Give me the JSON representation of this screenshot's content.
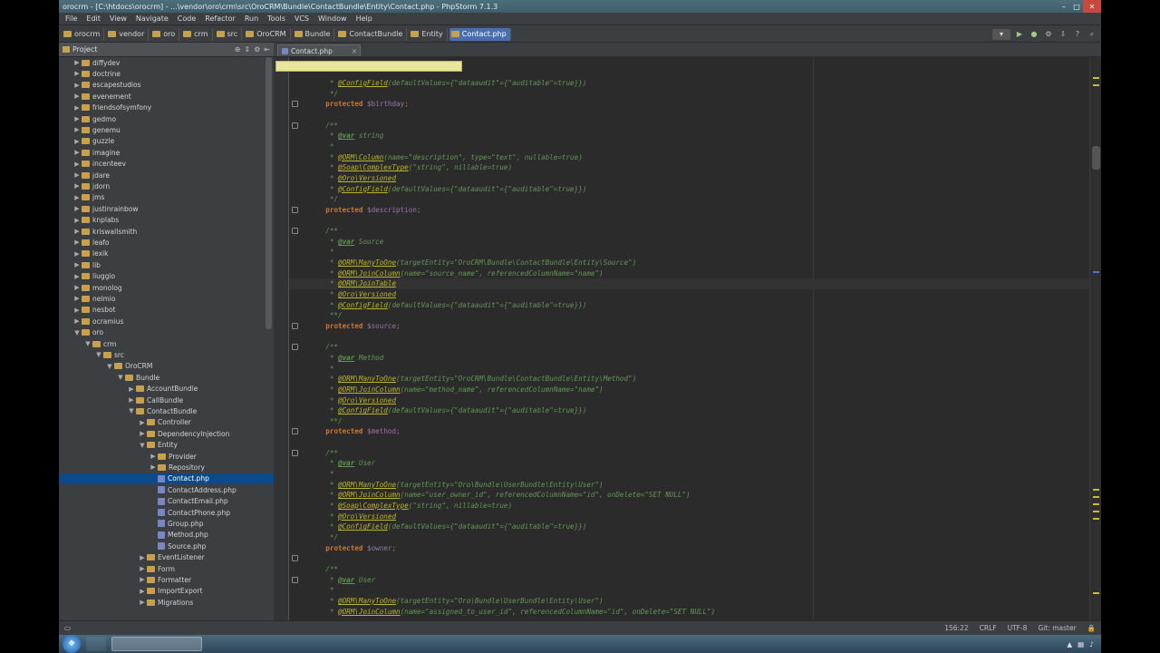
{
  "window": {
    "title": "orocrm - [C:\\htdocs\\orocrm] - ...\\vendor\\oro\\crm\\src\\OroCRM\\Bundle\\ContactBundle\\Entity\\Contact.php - PhpStorm 7.1.3"
  },
  "menu": [
    "File",
    "Edit",
    "View",
    "Navigate",
    "Code",
    "Refactor",
    "Run",
    "Tools",
    "VCS",
    "Window",
    "Help"
  ],
  "breadcrumbs": [
    "orocrm",
    "vendor",
    "oro",
    "crm",
    "src",
    "OroCRM",
    "Bundle",
    "ContactBundle",
    "Entity",
    "Contact.php"
  ],
  "project": {
    "title": "Project",
    "tree": [
      {
        "label": "diffydev",
        "depth": 3,
        "type": "folder",
        "arrow": "▶"
      },
      {
        "label": "doctrine",
        "depth": 3,
        "type": "folder",
        "arrow": "▶"
      },
      {
        "label": "escapestudios",
        "depth": 3,
        "type": "folder",
        "arrow": "▶"
      },
      {
        "label": "evenement",
        "depth": 3,
        "type": "folder",
        "arrow": "▶"
      },
      {
        "label": "friendsofsymfony",
        "depth": 3,
        "type": "folder",
        "arrow": "▶"
      },
      {
        "label": "gedmo",
        "depth": 3,
        "type": "folder",
        "arrow": "▶"
      },
      {
        "label": "genemu",
        "depth": 3,
        "type": "folder",
        "arrow": "▶"
      },
      {
        "label": "guzzle",
        "depth": 3,
        "type": "folder",
        "arrow": "▶"
      },
      {
        "label": "imagine",
        "depth": 3,
        "type": "folder",
        "arrow": "▶"
      },
      {
        "label": "incenteev",
        "depth": 3,
        "type": "folder",
        "arrow": "▶"
      },
      {
        "label": "jdare",
        "depth": 3,
        "type": "folder",
        "arrow": "▶"
      },
      {
        "label": "jdorn",
        "depth": 3,
        "type": "folder",
        "arrow": "▶"
      },
      {
        "label": "jms",
        "depth": 3,
        "type": "folder",
        "arrow": "▶"
      },
      {
        "label": "justinrainbow",
        "depth": 3,
        "type": "folder",
        "arrow": "▶"
      },
      {
        "label": "knplabs",
        "depth": 3,
        "type": "folder",
        "arrow": "▶"
      },
      {
        "label": "kriswallsmith",
        "depth": 3,
        "type": "folder",
        "arrow": "▶"
      },
      {
        "label": "leafo",
        "depth": 3,
        "type": "folder",
        "arrow": "▶"
      },
      {
        "label": "lexik",
        "depth": 3,
        "type": "folder",
        "arrow": "▶"
      },
      {
        "label": "lib",
        "depth": 3,
        "type": "folder",
        "arrow": "▶"
      },
      {
        "label": "liuggio",
        "depth": 3,
        "type": "folder",
        "arrow": "▶"
      },
      {
        "label": "monolog",
        "depth": 3,
        "type": "folder",
        "arrow": "▶"
      },
      {
        "label": "nelmio",
        "depth": 3,
        "type": "folder",
        "arrow": "▶"
      },
      {
        "label": "nesbot",
        "depth": 3,
        "type": "folder",
        "arrow": "▶"
      },
      {
        "label": "ocramius",
        "depth": 3,
        "type": "folder",
        "arrow": "▶"
      },
      {
        "label": "oro",
        "depth": 3,
        "type": "folder",
        "arrow": "▼"
      },
      {
        "label": "crm",
        "depth": 4,
        "type": "folder",
        "arrow": "▼"
      },
      {
        "label": "src",
        "depth": 5,
        "type": "folder",
        "arrow": "▼"
      },
      {
        "label": "OroCRM",
        "depth": 6,
        "type": "folder",
        "arrow": "▼"
      },
      {
        "label": "Bundle",
        "depth": 7,
        "type": "folder",
        "arrow": "▼"
      },
      {
        "label": "AccountBundle",
        "depth": 8,
        "type": "folder",
        "arrow": "▶"
      },
      {
        "label": "CallBundle",
        "depth": 8,
        "type": "folder",
        "arrow": "▶"
      },
      {
        "label": "ContactBundle",
        "depth": 8,
        "type": "folder",
        "arrow": "▼"
      },
      {
        "label": "Controller",
        "depth": 9,
        "type": "folder",
        "arrow": "▶"
      },
      {
        "label": "DependencyInjection",
        "depth": 9,
        "type": "folder",
        "arrow": "▶"
      },
      {
        "label": "Entity",
        "depth": 9,
        "type": "folder",
        "arrow": "▼"
      },
      {
        "label": "Provider",
        "depth": 10,
        "type": "folder",
        "arrow": "▶"
      },
      {
        "label": "Repository",
        "depth": 10,
        "type": "folder",
        "arrow": "▶"
      },
      {
        "label": "Contact.php",
        "depth": 10,
        "type": "php",
        "arrow": "",
        "selected": true
      },
      {
        "label": "ContactAddress.php",
        "depth": 10,
        "type": "php",
        "arrow": ""
      },
      {
        "label": "ContactEmail.php",
        "depth": 10,
        "type": "php",
        "arrow": ""
      },
      {
        "label": "ContactPhone.php",
        "depth": 10,
        "type": "php",
        "arrow": ""
      },
      {
        "label": "Group.php",
        "depth": 10,
        "type": "php",
        "arrow": ""
      },
      {
        "label": "Method.php",
        "depth": 10,
        "type": "php",
        "arrow": ""
      },
      {
        "label": "Source.php",
        "depth": 10,
        "type": "php",
        "arrow": ""
      },
      {
        "label": "EventListener",
        "depth": 9,
        "type": "folder",
        "arrow": "▶"
      },
      {
        "label": "Form",
        "depth": 9,
        "type": "folder",
        "arrow": "▶"
      },
      {
        "label": "Formatter",
        "depth": 9,
        "type": "folder",
        "arrow": "▶"
      },
      {
        "label": "ImportExport",
        "depth": 9,
        "type": "folder",
        "arrow": "▶"
      },
      {
        "label": "Migrations",
        "depth": 9,
        "type": "folder",
        "arrow": "▶"
      }
    ]
  },
  "editor": {
    "tab": "Contact.php",
    "lines": [
      [
        {
          "t": "     * "
        },
        {
          "t": "@ConfigField",
          "c": "ann"
        },
        {
          "t": "(defaultValues={\"dataaudit\"={\"auditable\"=true}})"
        }
      ],
      [
        {
          "t": "     */"
        }
      ],
      [
        {
          "t": "    "
        },
        {
          "t": "protected",
          "c": "kw"
        },
        {
          "t": " "
        },
        {
          "t": "$birthday",
          "c": "var"
        },
        {
          "t": ";",
          "c": "semi"
        }
      ],
      [
        {
          "t": ""
        }
      ],
      [
        {
          "t": "    /**"
        }
      ],
      [
        {
          "t": "     * "
        },
        {
          "t": "@var",
          "c": "tag"
        },
        {
          "t": " string"
        }
      ],
      [
        {
          "t": "     *"
        }
      ],
      [
        {
          "t": "     * "
        },
        {
          "t": "@ORM\\Column",
          "c": "ann"
        },
        {
          "t": "(name=\"description\", type=\"text\", nullable=true)"
        }
      ],
      [
        {
          "t": "     * "
        },
        {
          "t": "@Soap\\ComplexType",
          "c": "ann"
        },
        {
          "t": "(\"string\", nillable=true)"
        }
      ],
      [
        {
          "t": "     * "
        },
        {
          "t": "@Oro\\Versioned",
          "c": "ann"
        }
      ],
      [
        {
          "t": "     * "
        },
        {
          "t": "@ConfigField",
          "c": "ann"
        },
        {
          "t": "(defaultValues={\"dataaudit\"={\"auditable\"=true}})"
        }
      ],
      [
        {
          "t": "     */"
        }
      ],
      [
        {
          "t": "    "
        },
        {
          "t": "protected",
          "c": "kw"
        },
        {
          "t": " "
        },
        {
          "t": "$description",
          "c": "var"
        },
        {
          "t": ";",
          "c": "semi"
        }
      ],
      [
        {
          "t": ""
        }
      ],
      [
        {
          "t": "    /**"
        }
      ],
      [
        {
          "t": "     * "
        },
        {
          "t": "@var",
          "c": "tag"
        },
        {
          "t": " Source"
        }
      ],
      [
        {
          "t": "     *"
        }
      ],
      [
        {
          "t": "     * "
        },
        {
          "t": "@ORM\\ManyToOne",
          "c": "ann"
        },
        {
          "t": "(targetEntity=\"OroCRM\\Bundle\\ContactBundle\\Entity\\Source\")"
        }
      ],
      [
        {
          "t": "     * "
        },
        {
          "t": "@ORM\\JoinColumn",
          "c": "ann"
        },
        {
          "t": "(name=\"source_name\", referencedColumnName=\"name\")"
        }
      ],
      [
        {
          "t": "     * "
        },
        {
          "t": "@ORM\\JoinTable",
          "c": "ann"
        }
      ],
      [
        {
          "t": "     * "
        },
        {
          "t": "@Oro\\Versioned",
          "c": "ann"
        }
      ],
      [
        {
          "t": "     * "
        },
        {
          "t": "@ConfigField",
          "c": "ann"
        },
        {
          "t": "(defaultValues={\"dataaudit\"={\"auditable\"=true}})"
        }
      ],
      [
        {
          "t": "     **/"
        }
      ],
      [
        {
          "t": "    "
        },
        {
          "t": "protected",
          "c": "kw"
        },
        {
          "t": " "
        },
        {
          "t": "$source",
          "c": "var"
        },
        {
          "t": ";",
          "c": "semi"
        }
      ],
      [
        {
          "t": ""
        }
      ],
      [
        {
          "t": "    /**"
        }
      ],
      [
        {
          "t": "     * "
        },
        {
          "t": "@var",
          "c": "tag"
        },
        {
          "t": " Method"
        }
      ],
      [
        {
          "t": "     *"
        }
      ],
      [
        {
          "t": "     * "
        },
        {
          "t": "@ORM\\ManyToOne",
          "c": "ann"
        },
        {
          "t": "(targetEntity=\"OroCRM\\Bundle\\ContactBundle\\Entity\\Method\")"
        }
      ],
      [
        {
          "t": "     * "
        },
        {
          "t": "@ORM\\JoinColumn",
          "c": "ann"
        },
        {
          "t": "(name=\"method_name\", referencedColumnName=\"name\")"
        }
      ],
      [
        {
          "t": "     * "
        },
        {
          "t": "@Oro\\Versioned",
          "c": "ann"
        }
      ],
      [
        {
          "t": "     * "
        },
        {
          "t": "@ConfigField",
          "c": "ann"
        },
        {
          "t": "(defaultValues={\"dataaudit\"={\"auditable\"=true}})"
        }
      ],
      [
        {
          "t": "     **/"
        }
      ],
      [
        {
          "t": "    "
        },
        {
          "t": "protected",
          "c": "kw"
        },
        {
          "t": " "
        },
        {
          "t": "$method",
          "c": "var"
        },
        {
          "t": ";",
          "c": "semi"
        }
      ],
      [
        {
          "t": ""
        }
      ],
      [
        {
          "t": "    /**"
        }
      ],
      [
        {
          "t": "     * "
        },
        {
          "t": "@var",
          "c": "tag"
        },
        {
          "t": " User"
        }
      ],
      [
        {
          "t": "     *"
        }
      ],
      [
        {
          "t": "     * "
        },
        {
          "t": "@ORM\\ManyToOne",
          "c": "ann"
        },
        {
          "t": "(targetEntity=\"Oro\\Bundle\\UserBundle\\Entity\\User\")"
        }
      ],
      [
        {
          "t": "     * "
        },
        {
          "t": "@ORM\\JoinColumn",
          "c": "ann"
        },
        {
          "t": "(name=\"user_owner_id\", referencedColumnName=\"id\", onDelete=\"SET NULL\")"
        }
      ],
      [
        {
          "t": "     * "
        },
        {
          "t": "@Soap\\ComplexType",
          "c": "ann"
        },
        {
          "t": "(\"string\", nillable=true)"
        }
      ],
      [
        {
          "t": "     * "
        },
        {
          "t": "@Oro\\Versioned",
          "c": "ann"
        }
      ],
      [
        {
          "t": "     * "
        },
        {
          "t": "@ConfigField",
          "c": "ann"
        },
        {
          "t": "(defaultValues={\"dataaudit\"={\"auditable\"=true}})"
        }
      ],
      [
        {
          "t": "     */"
        }
      ],
      [
        {
          "t": "    "
        },
        {
          "t": "protected",
          "c": "kw"
        },
        {
          "t": " "
        },
        {
          "t": "$owner",
          "c": "var"
        },
        {
          "t": ";",
          "c": "semi"
        }
      ],
      [
        {
          "t": ""
        }
      ],
      [
        {
          "t": "    /**"
        }
      ],
      [
        {
          "t": "     * "
        },
        {
          "t": "@var",
          "c": "tag"
        },
        {
          "t": " User"
        }
      ],
      [
        {
          "t": "     *"
        }
      ],
      [
        {
          "t": "     * "
        },
        {
          "t": "@ORM\\ManyToOne",
          "c": "ann"
        },
        {
          "t": "(targetEntity=\"Oro\\Bundle\\UserBundle\\Entity\\User\")"
        }
      ],
      [
        {
          "t": "     * "
        },
        {
          "t": "@ORM\\JoinColumn",
          "c": "ann"
        },
        {
          "t": "(name=\"assigned_to_user_id\", referencedColumnName=\"id\", onDelete=\"SET NULL\")"
        }
      ]
    ]
  },
  "status": {
    "position": "156:22",
    "line_sep": "CRLF",
    "encoding": "UTF-8",
    "git": "Git: master"
  },
  "colors": {
    "keyword": "#cc7832",
    "annotation": "#bbb529",
    "doc_comment": "#629755",
    "variable": "#9876aa",
    "selection": "#0d4a8a"
  }
}
